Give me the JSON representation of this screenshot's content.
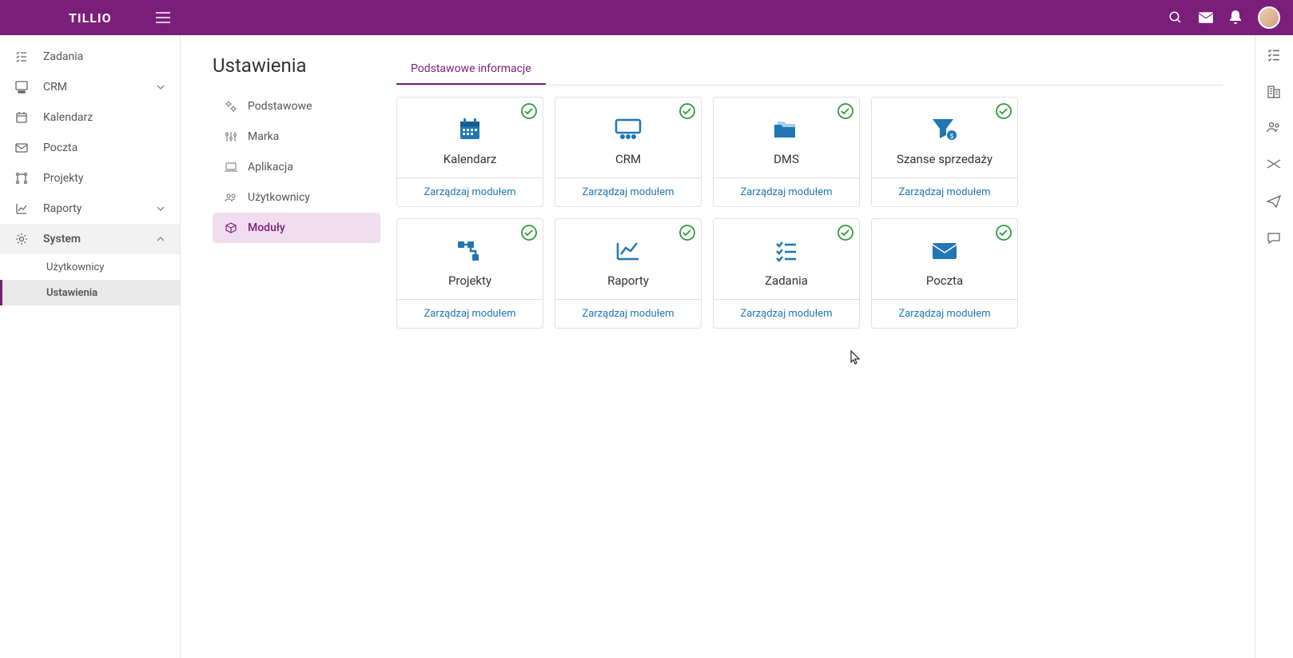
{
  "brand": "TILLIO",
  "page": {
    "title": "Ustawienia"
  },
  "sidebar": {
    "items": [
      {
        "label": "Zadania"
      },
      {
        "label": "CRM"
      },
      {
        "label": "Kalendarz"
      },
      {
        "label": "Poczta"
      },
      {
        "label": "Projekty"
      },
      {
        "label": "Raporty"
      },
      {
        "label": "System"
      }
    ],
    "system_sub": [
      {
        "label": "Użytkownicy"
      },
      {
        "label": "Ustawienia"
      }
    ]
  },
  "settings_nav": [
    {
      "label": "Podstawowe"
    },
    {
      "label": "Marka"
    },
    {
      "label": "Aplikacja"
    },
    {
      "label": "Użytkownicy"
    },
    {
      "label": "Moduły"
    }
  ],
  "tab": {
    "label": "Podstawowe informacje"
  },
  "modules": [
    {
      "title": "Kalendarz",
      "action": "Zarządzaj modułem"
    },
    {
      "title": "CRM",
      "action": "Zarządzaj modułem"
    },
    {
      "title": "DMS",
      "action": "Zarządzaj modułem"
    },
    {
      "title": "Szanse sprzedaży",
      "action": "Zarządzaj modułem"
    },
    {
      "title": "Projekty",
      "action": "Zarządzaj modułem"
    },
    {
      "title": "Raporty",
      "action": "Zarządzaj modułem"
    },
    {
      "title": "Zadania",
      "action": "Zarządzaj modułem"
    },
    {
      "title": "Poczta",
      "action": "Zarządzaj modułem"
    }
  ]
}
